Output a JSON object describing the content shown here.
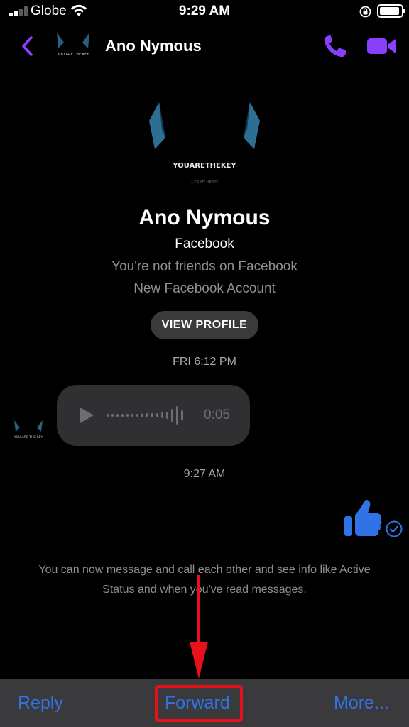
{
  "status_bar": {
    "carrier": "Globe",
    "time": "9:29 AM",
    "battery_level": 0.92
  },
  "header": {
    "contact_name": "Ano Nymous",
    "avatar_caption": "YOU ARE THE KEY",
    "back_icon": "chevron-left-icon",
    "call_icon": "phone-icon",
    "video_icon": "video-camera-icon",
    "accent_color": "#8a3ffc"
  },
  "profile": {
    "name": "Ano Nymous",
    "avatar_caption": "YOUARETHEKEY",
    "avatar_subcaption": "...TO MY HEART",
    "platform": "Facebook",
    "friend_status": "You're not friends on Facebook",
    "account_note": "New Facebook Account",
    "view_profile_label": "VIEW PROFILE"
  },
  "conversation": {
    "timestamp_1": "FRI 6:12 PM",
    "voice_message": {
      "duration": "0:05",
      "avatar_caption": "YOU ARE THE KEY"
    },
    "timestamp_2": "9:27 AM",
    "sent_like": {
      "icon": "thumbs-up-icon",
      "status_icon": "sent-check-icon",
      "color": "#2f73e6"
    },
    "info_text": "You can now message and call each other and see info like Active Status and when you've read messages."
  },
  "toolbar": {
    "reply_label": "Reply",
    "forward_label": "Forward",
    "more_label": "More...",
    "highlight_color": "#e8101a"
  }
}
